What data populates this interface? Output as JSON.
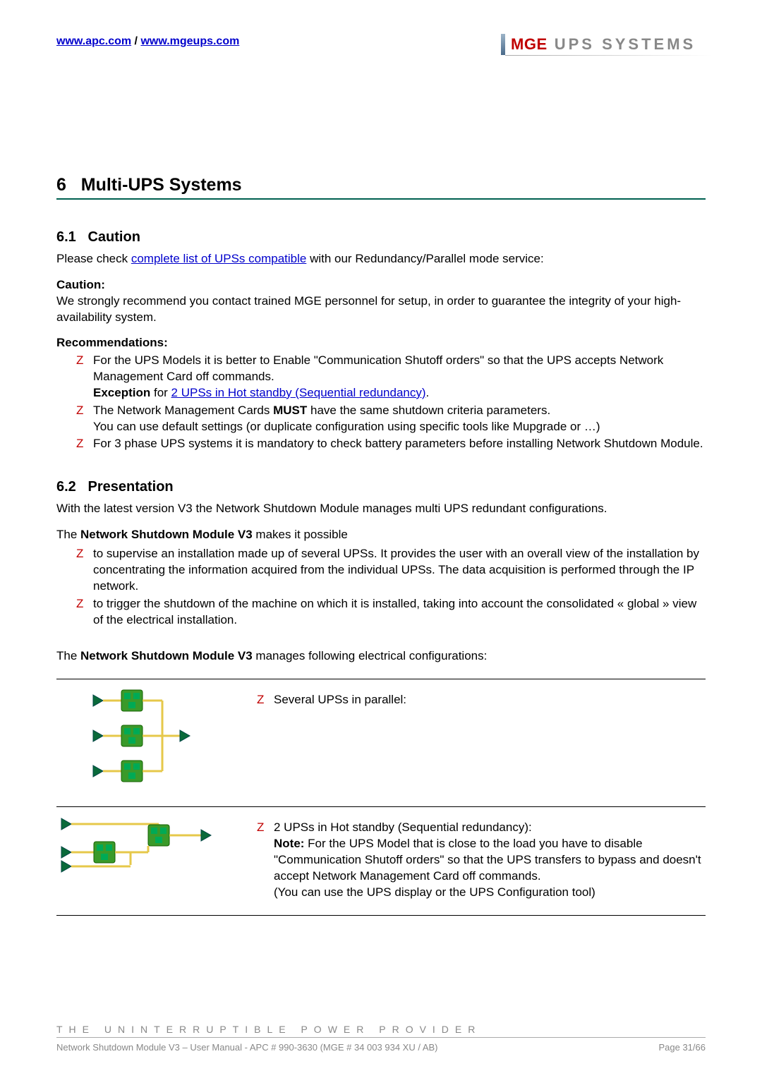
{
  "header": {
    "link1": "www.apc.com",
    "separator": " / ",
    "link2": "www.mgeups.com",
    "logo_mge": "MGE",
    "logo_rest": " UPS  SYSTEMS"
  },
  "section_number": "6",
  "section_title": "Multi-UPS Systems",
  "s61": {
    "number": "6.1",
    "title": "Caution",
    "intro_pre": "Please check ",
    "intro_link": "complete list of UPSs compatible",
    "intro_post": " with our Redundancy/Parallel mode service:",
    "caution_label": "Caution:",
    "caution_text": "We strongly recommend you contact trained MGE personnel for setup, in order to guarantee the integrity of your high-availability system.",
    "rec_label": "Recommendations:",
    "rec_items": [
      {
        "text": "For the UPS Models it is better to Enable \"Communication Shutoff orders\" so that the UPS accepts Network Management Card off commands.",
        "exception_label": "Exception",
        "exception_mid": " for ",
        "exception_link": "2 UPSs in Hot standby (Sequential redundancy)",
        "exception_post": "."
      },
      {
        "pre": "The Network Management Cards ",
        "bold": "MUST",
        "post": " have the same shutdown criteria parameters.",
        "line2": "You can use default settings (or duplicate configuration using specific tools like Mupgrade or …)"
      },
      {
        "text": "For 3 phase UPS systems it is mandatory to check battery parameters before installing Network Shutdown Module."
      }
    ]
  },
  "s62": {
    "number": "6.2",
    "title": "Presentation",
    "intro": "With the latest version V3 the Network Shutdown Module manages multi UPS redundant configurations.",
    "makes_pre": "The ",
    "makes_bold": "Network Shutdown Module V3",
    "makes_post": " makes it possible",
    "makes_items": [
      "to supervise an installation made up of several UPSs. It provides the user with an overall view of the installation by concentrating the information acquired from the individual UPSs. The data acquisition is performed through the IP network.",
      "to trigger the shutdown of the machine on which it is installed, taking into account the consolidated « global » view of the electrical installation."
    ],
    "manages_pre": "The ",
    "manages_bold": "Network Shutdown Module V3",
    "manages_post": " manages following electrical configurations:",
    "configs": [
      {
        "text": "Several UPSs in parallel:"
      },
      {
        "text": "2 UPSs in Hot standby (Sequential redundancy):",
        "note_label": "Note:",
        "note_text": " For the UPS Model that is close to the load you have to disable \"Communication Shutoff orders\" so that the UPS transfers to bypass and doesn't accept Network Management Card off commands.",
        "paren": "(You can use the UPS display or the UPS Configuration tool)"
      }
    ]
  },
  "footer": {
    "tagline": "THE UNINTERRUPTIBLE POWER PROVIDER",
    "doc": "Network Shutdown Module V3 – User Manual - APC # 990-3630 (MGE # 34 003 934 XU / AB)",
    "page": "Page 31/66"
  },
  "bullet_mark": "Z"
}
